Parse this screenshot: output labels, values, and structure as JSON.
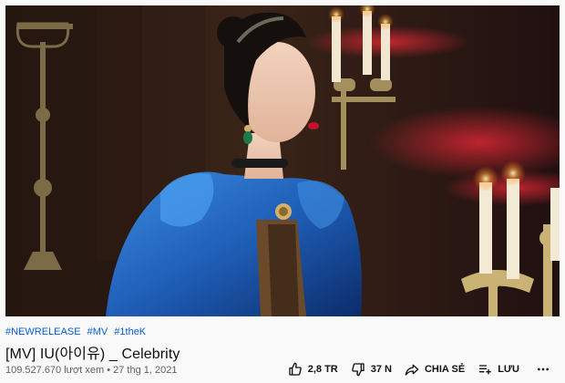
{
  "hashtags": [
    "#NEWRELEASE",
    "#MV",
    "#1theK"
  ],
  "video": {
    "title": "[MV] IU(아이유) _ Celebrity",
    "views": "109.527.670 lượt xem",
    "separator": "•",
    "date": "27 thg 1, 2021"
  },
  "actions": {
    "like_count": "2,8 TR",
    "dislike_count": "37 N",
    "share_label": "CHIA SẺ",
    "save_label": "LƯU"
  },
  "icons": {
    "like": "thumbs-up-icon",
    "dislike": "thumbs-down-icon",
    "share": "share-arrow-icon",
    "save": "playlist-add-icon",
    "more": "more-horizontal-icon"
  },
  "colors": {
    "hashtag": "#065fd4",
    "meta": "#606060",
    "dress": "#1f5fb8"
  }
}
